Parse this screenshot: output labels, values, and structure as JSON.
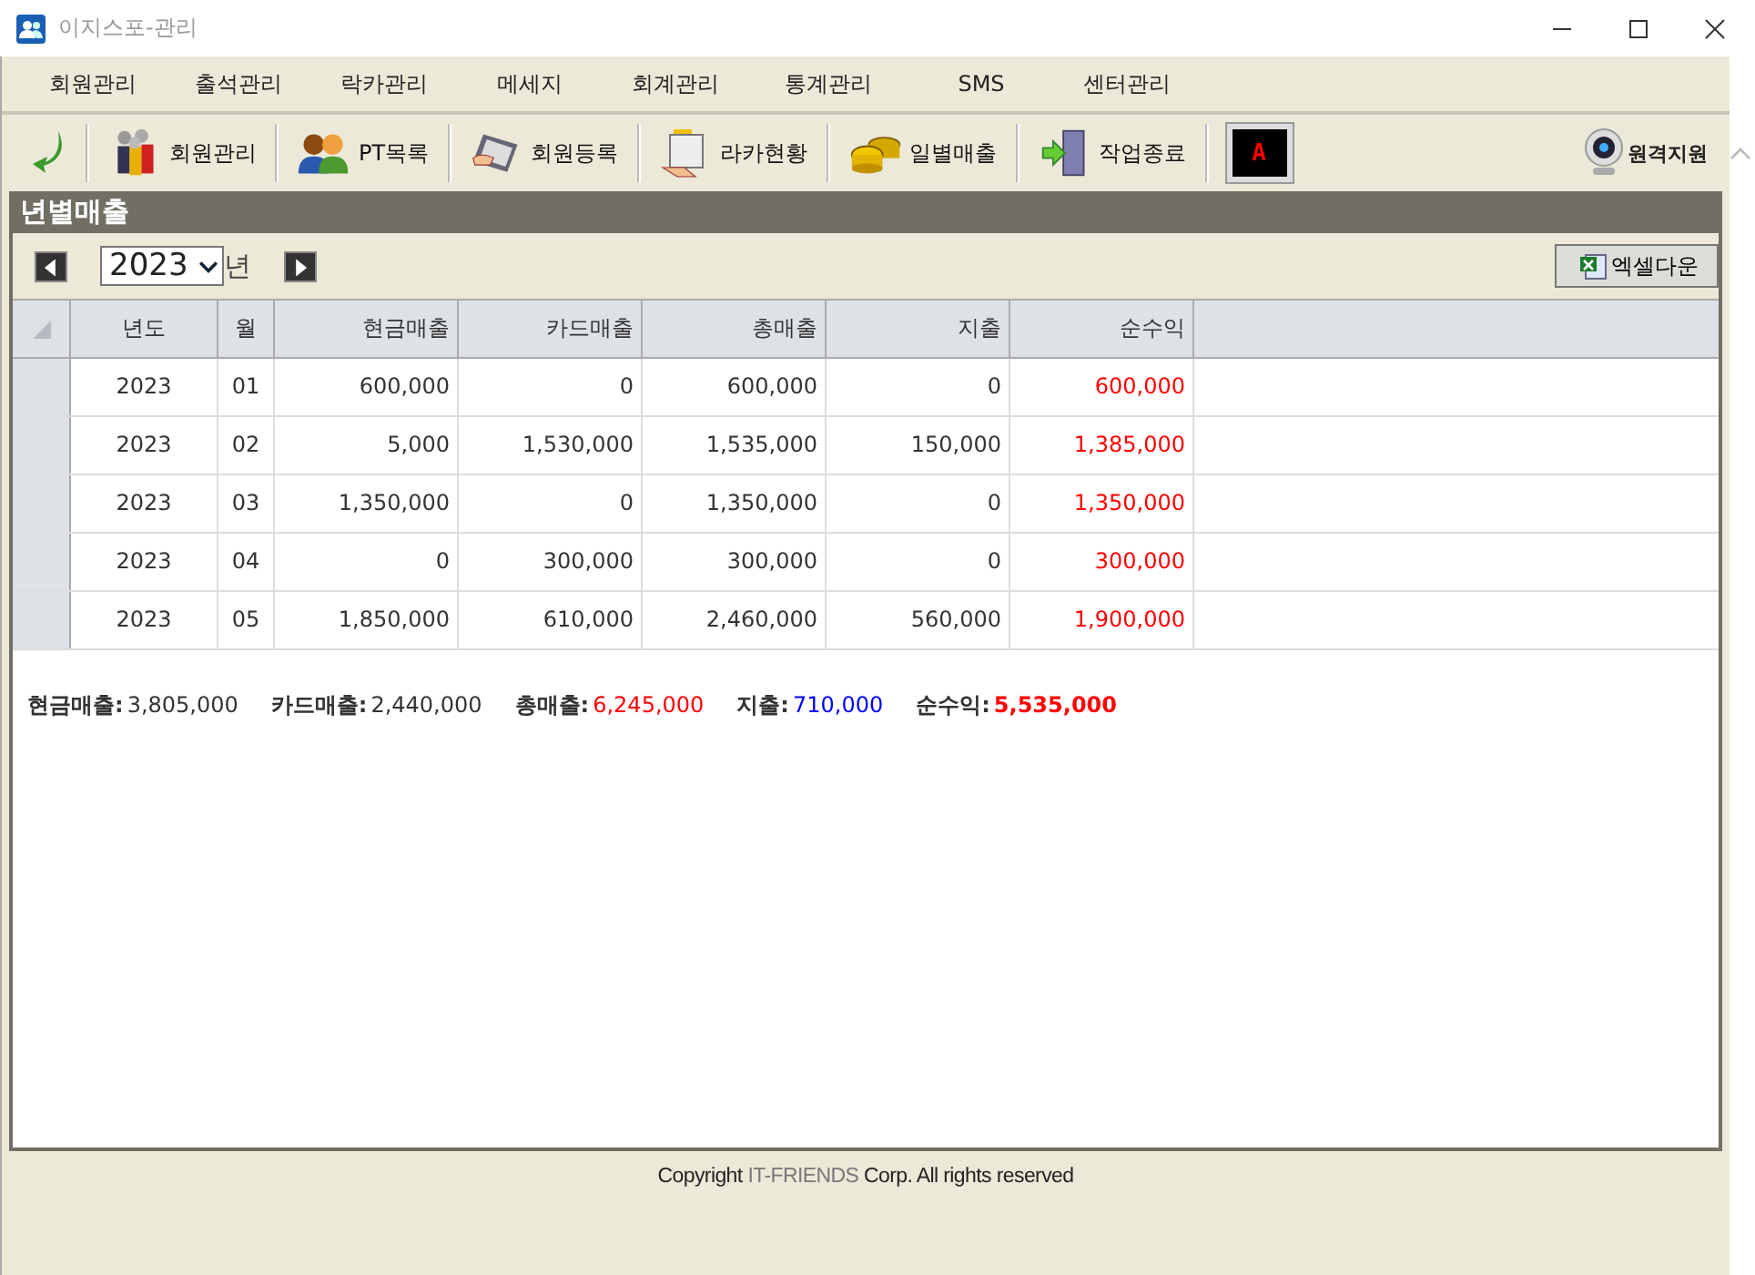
{
  "window": {
    "title": "이지스포-관리"
  },
  "menu": [
    "회원관리",
    "출석관리",
    "락카관리",
    "메세지",
    "회계관리",
    "통계관리",
    "SMS",
    "센터관리"
  ],
  "toolbar": [
    {
      "kind": "arrow"
    },
    {
      "kind": "members",
      "label": "회원관리"
    },
    {
      "kind": "pt",
      "label": "PT목록"
    },
    {
      "kind": "register",
      "label": "회원등록"
    },
    {
      "kind": "locker",
      "label": "라카현황"
    },
    {
      "kind": "coins",
      "label": "일별매출"
    },
    {
      "kind": "exit",
      "label": "작업종료"
    },
    {
      "kind": "alert",
      "label": "A"
    }
  ],
  "remote_support": "원격지원",
  "panel": {
    "title": "년별매출",
    "year": "2023",
    "year_unit": "년",
    "excel_button": "엑셀다운"
  },
  "table": {
    "columns": [
      "년도",
      "월",
      "현금매출",
      "카드매출",
      "총매출",
      "지출",
      "순수익"
    ],
    "rows": [
      [
        "2023",
        "01",
        "600,000",
        "0",
        "600,000",
        "0",
        "600,000"
      ],
      [
        "2023",
        "02",
        "5,000",
        "1,530,000",
        "1,535,000",
        "150,000",
        "1,385,000"
      ],
      [
        "2023",
        "03",
        "1,350,000",
        "0",
        "1,350,000",
        "0",
        "1,350,000"
      ],
      [
        "2023",
        "04",
        "0",
        "300,000",
        "300,000",
        "0",
        "300,000"
      ],
      [
        "2023",
        "05",
        "1,850,000",
        "610,000",
        "2,460,000",
        "560,000",
        "1,900,000"
      ]
    ]
  },
  "summary": [
    {
      "label": "현금매출:",
      "value": "3,805,000",
      "color": "#333333",
      "bold": false
    },
    {
      "label": "카드매출:",
      "value": "2,440,000",
      "color": "#333333",
      "bold": false
    },
    {
      "label": "총매출:",
      "value": "6,245,000",
      "color": "#ff0000",
      "bold": false
    },
    {
      "label": "지출:",
      "value": "710,000",
      "color": "#0000ff",
      "bold": false
    },
    {
      "label": "순수익:",
      "value": "5,535,000",
      "color": "#ff0000",
      "bold": true
    }
  ],
  "footer": {
    "prefix": "Copyright",
    "brand": "IT-FRIENDS",
    "suffix": "Corp. All rights reserved"
  }
}
